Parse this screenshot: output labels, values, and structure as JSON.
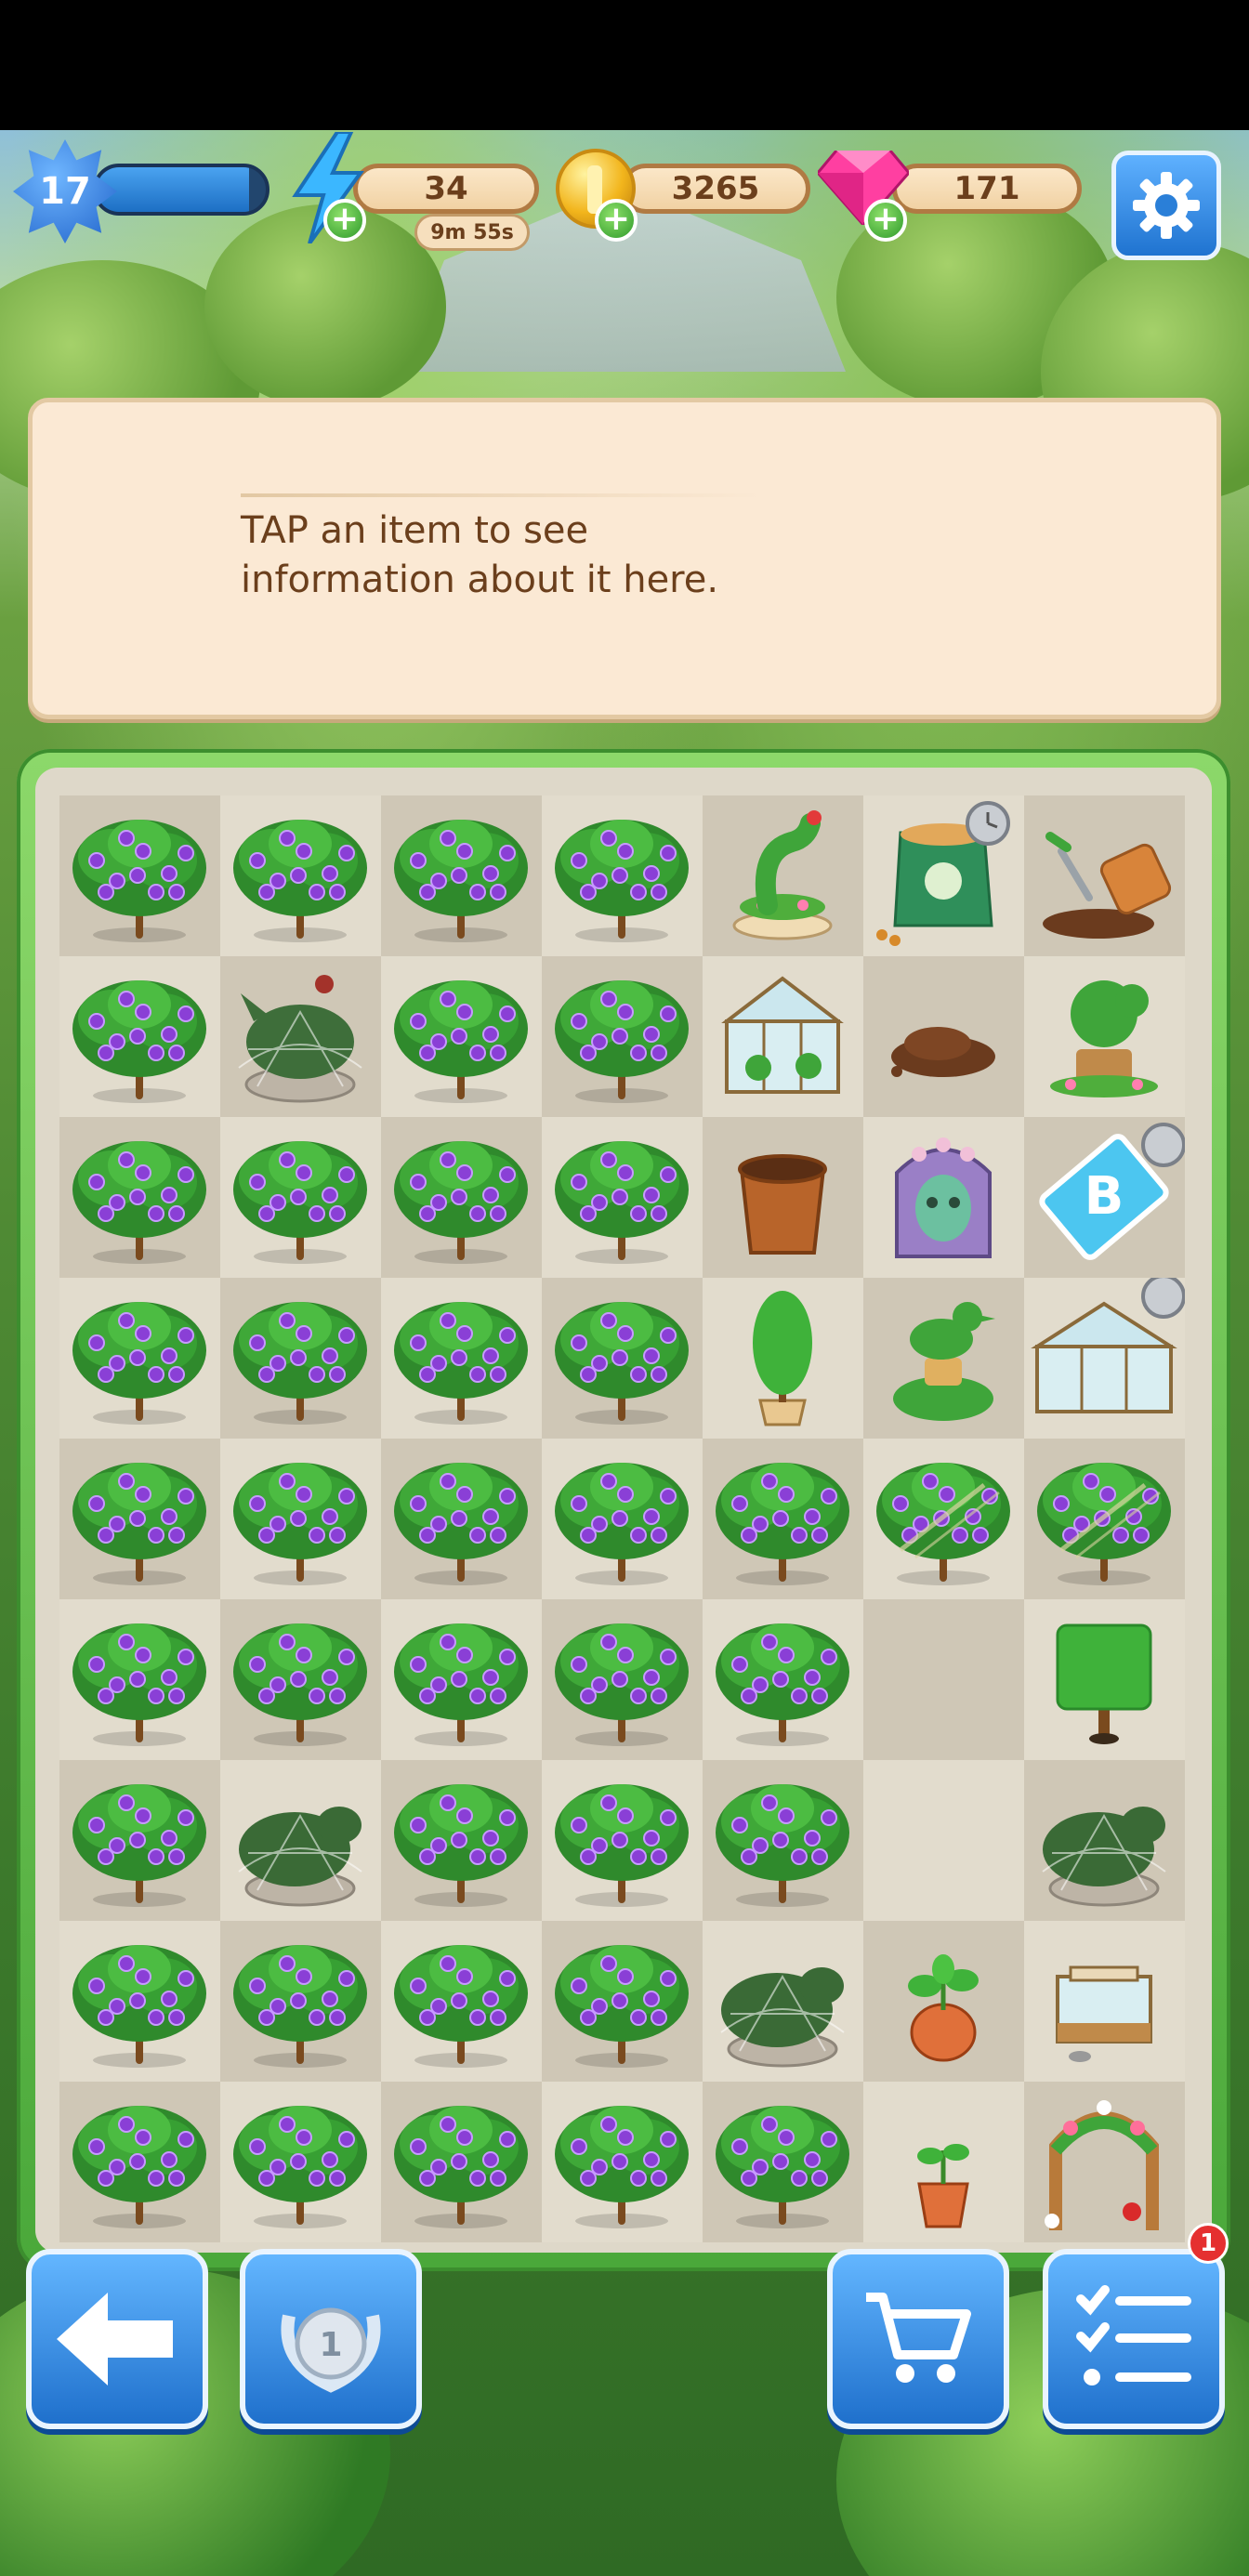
{
  "hud": {
    "level": "17",
    "xp_fraction": 0.9,
    "energy": "34",
    "energy_timer": "9m 55s",
    "coins": "3265",
    "gems": "171"
  },
  "info_panel": {
    "text": "TAP an item to see information about it here."
  },
  "board": {
    "rows": [
      [
        "flower-bush",
        "flower-bush",
        "flower-bush",
        "flower-bush",
        "bird-topiary",
        "seed-bag",
        "soil-pot-spill"
      ],
      [
        "flower-bush",
        "rhino-topiary-webbed",
        "flower-bush",
        "flower-bush",
        "greenhouse",
        "soil-pile",
        "sheep-topiary"
      ],
      [
        "flower-bush",
        "flower-bush",
        "flower-bush",
        "flower-bush",
        "soil-pot",
        "stone-mask-shrine",
        "booster-card"
      ],
      [
        "flower-bush",
        "flower-bush",
        "flower-bush",
        "flower-bush",
        "cypress-pot",
        "duck-topiary",
        "greenhouse-large"
      ],
      [
        "flower-bush",
        "flower-bush",
        "flower-bush",
        "flower-bush",
        "flower-bush",
        "flower-bush-sparkle",
        "flower-bush-sparkle"
      ],
      [
        "flower-bush",
        "flower-bush",
        "flower-bush",
        "flower-bush",
        "flower-bush",
        "empty",
        "cube-topiary"
      ],
      [
        "flower-bush",
        "turtle-topiary-webbed",
        "flower-bush",
        "flower-bush",
        "flower-bush",
        "empty",
        "turtle-topiary-webbed"
      ],
      [
        "flower-bush",
        "flower-bush",
        "flower-bush",
        "flower-bush",
        "turtle-topiary-webbed",
        "sprout-pot",
        "glass-planter"
      ],
      [
        "flower-bush",
        "flower-bush",
        "flower-bush",
        "flower-bush",
        "flower-bush",
        "seedling-pot",
        "rose-arch"
      ]
    ]
  },
  "bottom_bar": {
    "back_icon": "arrow-left-icon",
    "pass_level": "1",
    "shop_icon": "cart-icon",
    "tasks_icon": "checklist-icon",
    "tasks_badge": "1"
  },
  "colors": {
    "button_blue": "#1f70cc",
    "panel_bg": "#fbe9d4",
    "board_frame": "#4aa83a"
  }
}
